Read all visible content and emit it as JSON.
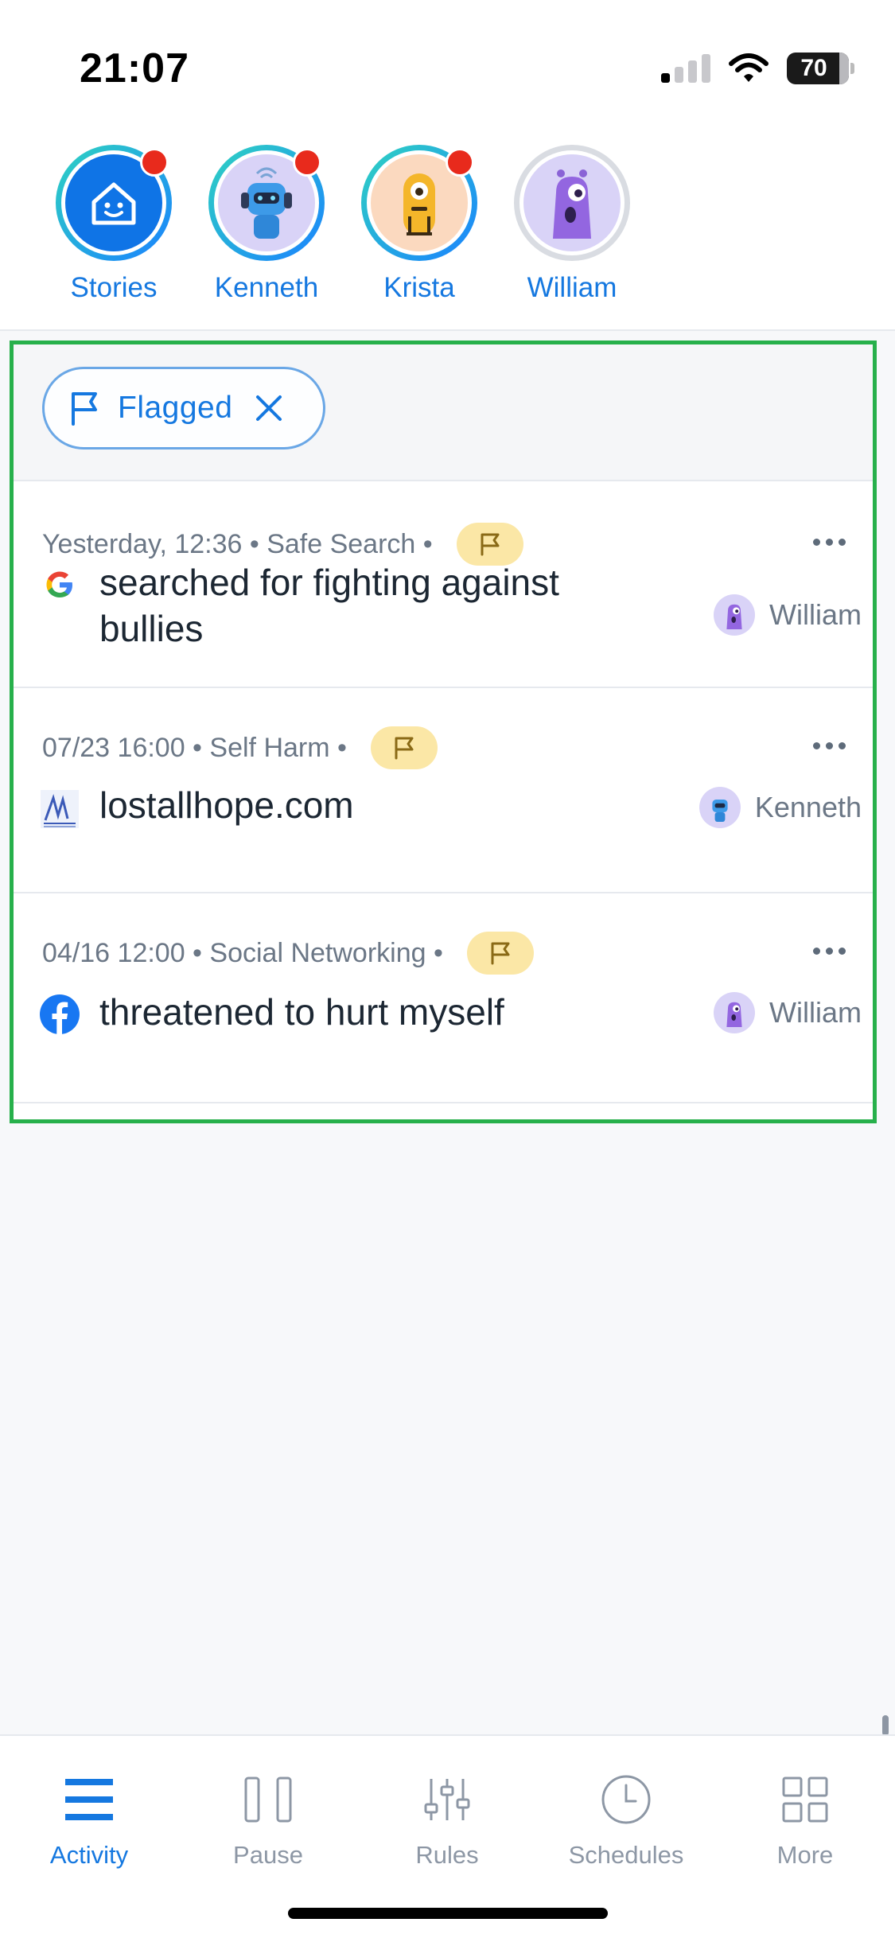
{
  "status": {
    "time": "21:07",
    "battery": "70"
  },
  "profiles": [
    {
      "name": "Stories",
      "notification": true
    },
    {
      "name": "Kenneth",
      "notification": true
    },
    {
      "name": "Krista",
      "notification": true
    },
    {
      "name": "William",
      "notification": false
    }
  ],
  "filter": {
    "label": "Flagged"
  },
  "activity": [
    {
      "meta": "Yesterday, 12:36 • Safe Search •",
      "title": "searched for fighting against bullies",
      "owner": "William",
      "site_icon": "google-icon"
    },
    {
      "meta": "07/23 16:00 • Self Harm •",
      "title": "lostallhope.com",
      "owner": "Kenneth",
      "site_icon": "site-logo-icon"
    },
    {
      "meta": "04/16 12:00 • Social Networking •",
      "title": "threatened to hurt myself",
      "owner": "William",
      "site_icon": "facebook-icon"
    }
  ],
  "tabs": [
    {
      "label": "Activity",
      "icon": "activity-list-icon",
      "active": true
    },
    {
      "label": "Pause",
      "icon": "pause-icon",
      "active": false
    },
    {
      "label": "Rules",
      "icon": "sliders-icon",
      "active": false
    },
    {
      "label": "Schedules",
      "icon": "clock-icon",
      "active": false
    },
    {
      "label": "More",
      "icon": "grid-icon",
      "active": false
    }
  ],
  "colors": {
    "accent": "#1578e0",
    "flag_badge": "#fbe7a6",
    "highlight_border": "#27b04b",
    "notification": "#e82a1c"
  }
}
